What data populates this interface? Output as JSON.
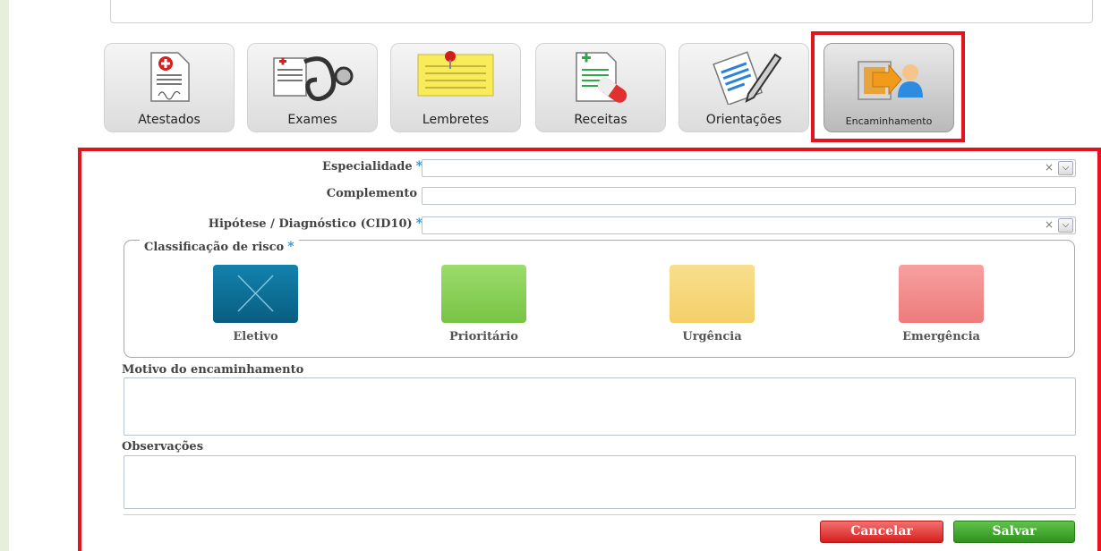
{
  "tiles": [
    {
      "label": "Atestados",
      "icon": "certificate-icon"
    },
    {
      "label": "Exames",
      "icon": "stethoscope-icon"
    },
    {
      "label": "Lembretes",
      "icon": "sticky-note-icon"
    },
    {
      "label": "Receitas",
      "icon": "prescription-icon"
    },
    {
      "label": "Orientações",
      "icon": "document-pen-icon"
    },
    {
      "label": "Encaminhamento",
      "icon": "referral-icon"
    }
  ],
  "form": {
    "especialidade_label": "Especialidade",
    "especialidade_value": "",
    "complemento_label": "Complemento",
    "complemento_value": "",
    "hipotese_label": "Hipótese / Diagnóstico (CID10)",
    "hipotese_value": "",
    "required_mark": "*",
    "clear_glyph": "×",
    "risk_legend": "Classificação de risco",
    "risk_options": [
      {
        "label": "Eletivo",
        "color": "#0d6f96",
        "selected": true
      },
      {
        "label": "Prioritário",
        "color": "#86d155",
        "selected": false
      },
      {
        "label": "Urgência",
        "color": "#f6d678",
        "selected": false
      },
      {
        "label": "Emergência",
        "color": "#f28c8c",
        "selected": false
      }
    ],
    "motivo_label": "Motivo do encaminhamento",
    "motivo_value": "",
    "observacoes_label": "Observações",
    "observacoes_value": ""
  },
  "buttons": {
    "cancel_label": "Cancelar",
    "save_label": "Salvar"
  },
  "colors": {
    "highlight": "#e3141e",
    "required": "#1c8fe8",
    "background": "#e6efd9"
  }
}
